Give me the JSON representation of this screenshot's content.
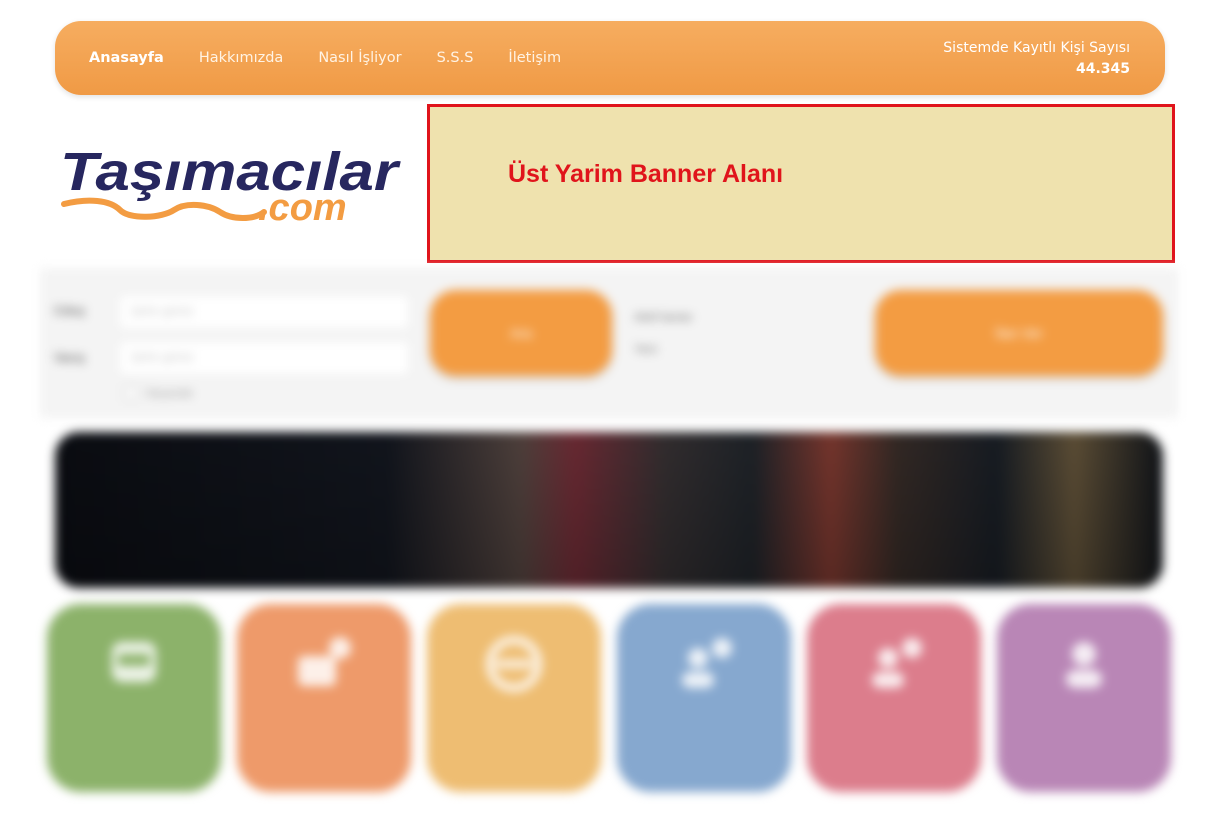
{
  "nav": {
    "links": [
      {
        "label": "Anasayfa",
        "active": true
      },
      {
        "label": "Hakkımızda",
        "active": false
      },
      {
        "label": "Nasıl İşliyor",
        "active": false
      },
      {
        "label": "S.S.S",
        "active": false
      },
      {
        "label": "İletişim",
        "active": false
      }
    ],
    "registered_label": "Sistemde Kayıtlı Kişi Sayısı",
    "registered_count": "44.345"
  },
  "logo": {
    "brand": "Taşımacılar",
    "suffix": ".com"
  },
  "banner": {
    "text": "Üst Yarim Banner Alanı",
    "border_color": "#e0141b",
    "background": "#efe2ae"
  },
  "colors": {
    "accent": "#f39c42",
    "logo_navy": "#27275f",
    "tile_green": "#8cb26a",
    "tile_orange": "#ee9a6a",
    "tile_yellow": "#eebd72",
    "tile_blue": "#86a8cf",
    "tile_pink": "#dc7d8c",
    "tile_purple": "#b986b6"
  },
  "tiles": [
    {
      "icon": "truck-icon"
    },
    {
      "icon": "team-truck-icon"
    },
    {
      "icon": "steering-wheel-icon"
    },
    {
      "icon": "user-plus-icon"
    },
    {
      "icon": "user-plus-icon"
    },
    {
      "icon": "user-icon"
    }
  ]
}
